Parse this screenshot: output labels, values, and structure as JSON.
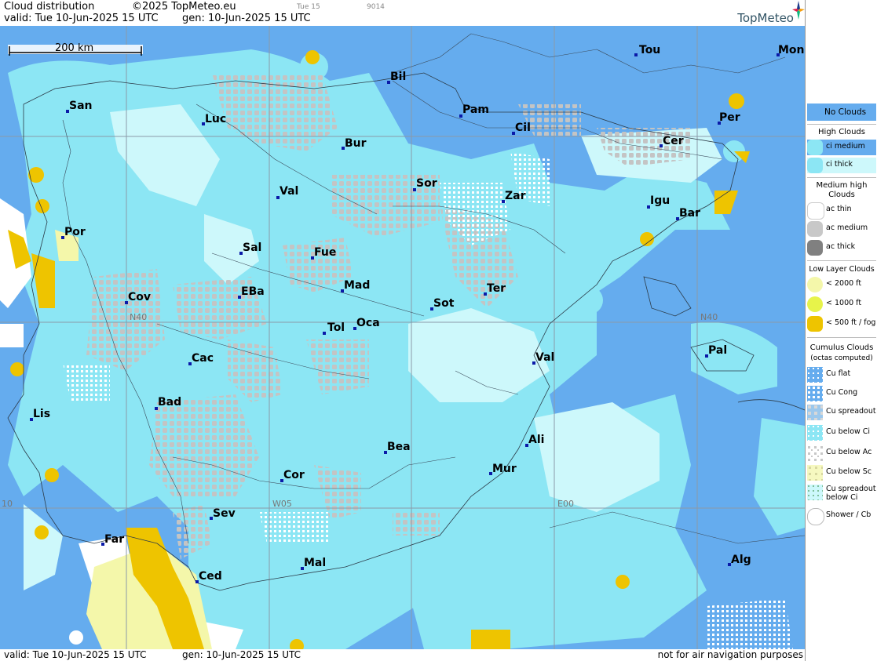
{
  "header": {
    "product": "Cloud distribution",
    "copyright": "©2025 TopMeteo.eu",
    "valid": "valid:  Tue  10-Jun-2025  15 UTC",
    "gen": "gen: 10-Jun-2025 15 UTC",
    "tab": "Tue 15",
    "code": "9014",
    "logo": "TopMeteo"
  },
  "footer": {
    "valid": "valid:  Tue  10-Jun-2025  15 UTC",
    "gen": "gen: 10-Jun-2025 15 UTC",
    "disclaimer": "not for air navigation purposes"
  },
  "scale_label": "200 km",
  "grid_labels": [
    "N40",
    "N40",
    "W05",
    "E00",
    "10"
  ],
  "colors": {
    "no_clouds": "#65acee",
    "ci_medium": "#8ce6f4",
    "ci_thick": "#cdf8fb",
    "cu_grey": "#c0c0c0",
    "fog_yellow": "#eec400",
    "low_light": "#f4f7aa",
    "city_marker": "#0a1aa8"
  },
  "cities": [
    {
      "name": "Tou"
    },
    {
      "name": "Mon"
    },
    {
      "name": "Bil"
    },
    {
      "name": "San"
    },
    {
      "name": "Pam"
    },
    {
      "name": "Luc"
    },
    {
      "name": "Per"
    },
    {
      "name": "Cil"
    },
    {
      "name": "Cer"
    },
    {
      "name": "Bur"
    },
    {
      "name": "Sor"
    },
    {
      "name": "Val"
    },
    {
      "name": "Zar"
    },
    {
      "name": "Igu"
    },
    {
      "name": "Bar"
    },
    {
      "name": "Por"
    },
    {
      "name": "Sal"
    },
    {
      "name": "Fue"
    },
    {
      "name": "Mad"
    },
    {
      "name": "Ter"
    },
    {
      "name": "Cov"
    },
    {
      "name": "EBa"
    },
    {
      "name": "Sot"
    },
    {
      "name": "Tol"
    },
    {
      "name": "Oca"
    },
    {
      "name": "Pal"
    },
    {
      "name": "Cac"
    },
    {
      "name": "Val"
    },
    {
      "name": "Bad"
    },
    {
      "name": "Lis"
    },
    {
      "name": "Ali"
    },
    {
      "name": "Bea"
    },
    {
      "name": "Mur"
    },
    {
      "name": "Cor"
    },
    {
      "name": "Sev"
    },
    {
      "name": "Far"
    },
    {
      "name": "Mal"
    },
    {
      "name": "Alg"
    },
    {
      "name": "Ced"
    }
  ],
  "legend": {
    "no_clouds": "No Clouds",
    "high_title": "High Clouds",
    "ci_medium": "ci medium",
    "ci_thick": "ci thick",
    "medium_title": "Medium high Clouds",
    "ac_thin": "ac thin",
    "ac_medium": "ac medium",
    "ac_thick": "ac thick",
    "low_title": "Low Layer Clouds",
    "low_2000": "< 2000 ft",
    "low_1000": "< 1000 ft",
    "low_500": "< 500 ft / fog",
    "cu_title": "Cumulus Clouds",
    "cu_subtitle": "(octas computed)",
    "cu_flat": "Cu flat",
    "cu_cong": "Cu Cong",
    "cu_spread": "Cu spreadout",
    "cu_below_ci": "Cu below Ci",
    "cu_below_ac": "Cu below Ac",
    "cu_below_sc": "Cu below Sc",
    "cu_spread_below_ci": "Cu spreadout below Ci",
    "shower": "Shower / Cb"
  }
}
